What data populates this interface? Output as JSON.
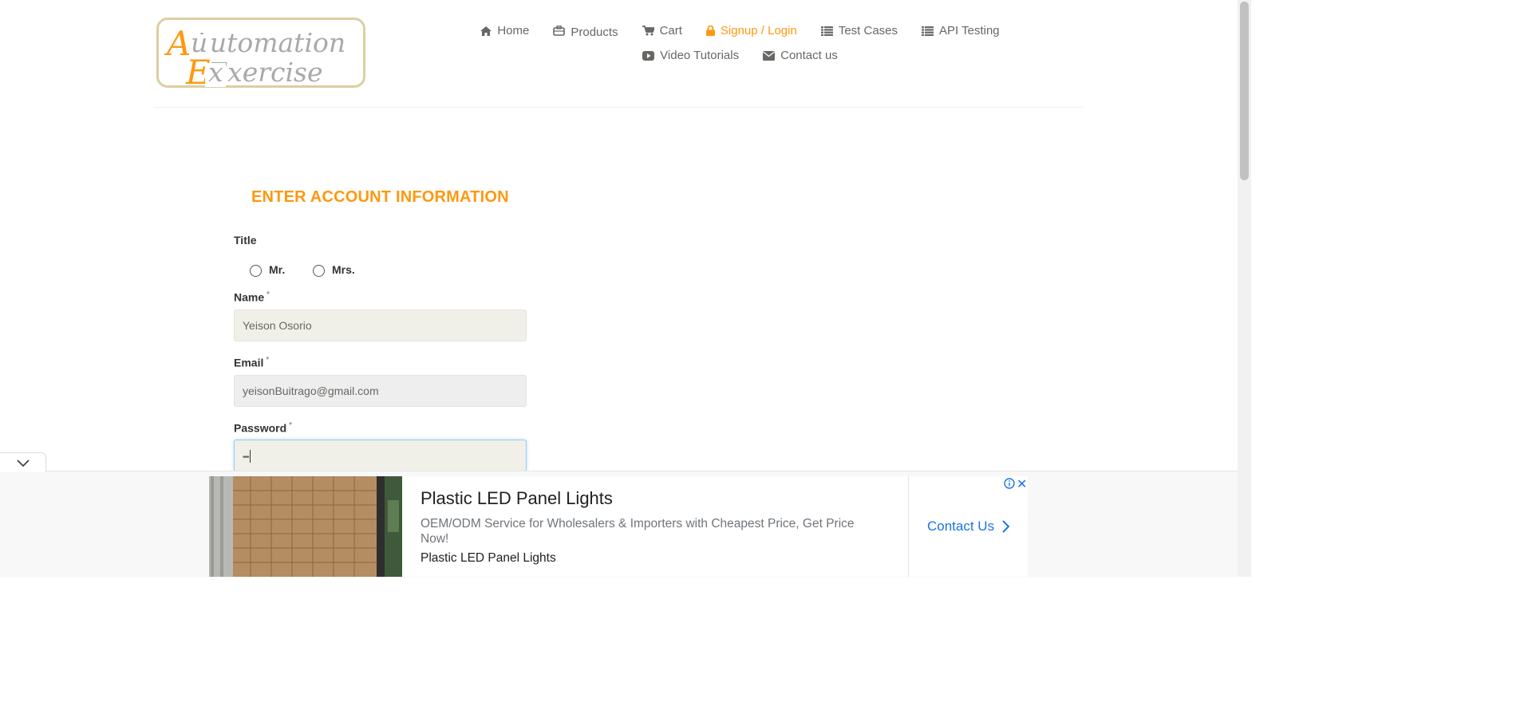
{
  "logo": {
    "line1": "Automation",
    "line2": "Exercise"
  },
  "nav": {
    "row1": [
      {
        "label": "Home",
        "icon": "home-icon",
        "active": false
      },
      {
        "label": "Products",
        "icon": "briefcase-icon",
        "active": false
      },
      {
        "label": "Cart",
        "icon": "cart-icon",
        "active": false
      },
      {
        "label": "Signup / Login",
        "icon": "lock-icon",
        "active": true
      },
      {
        "label": "Test Cases",
        "icon": "list-icon",
        "active": false
      },
      {
        "label": "API Testing",
        "icon": "list-icon",
        "active": false
      }
    ],
    "row2": [
      {
        "label": "Video Tutorials",
        "icon": "youtube-icon",
        "active": false
      },
      {
        "label": "Contact us",
        "icon": "envelope-icon",
        "active": false
      }
    ]
  },
  "form": {
    "heading": "ENTER ACCOUNT INFORMATION",
    "title_label": "Title",
    "title_options": [
      "Mr.",
      "Mrs."
    ],
    "name_label": "Name",
    "name_value": "Yeison Osorio",
    "email_label": "Email",
    "email_value": "yeisonBuitrago@gmail.com",
    "password_label": "Password",
    "password_mask": "•••",
    "required_mark": "*"
  },
  "ad": {
    "title": "Plastic LED Panel Lights",
    "description": "OEM/ODM Service for Wholesalers & Importers with Cheapest Price, Get Price Now!",
    "subtitle": "Plastic LED Panel Lights",
    "cta": "Contact Us",
    "close": "✕"
  },
  "colors": {
    "accent": "#fe980f",
    "text": "#696763",
    "ad_link": "#1a73e8"
  }
}
